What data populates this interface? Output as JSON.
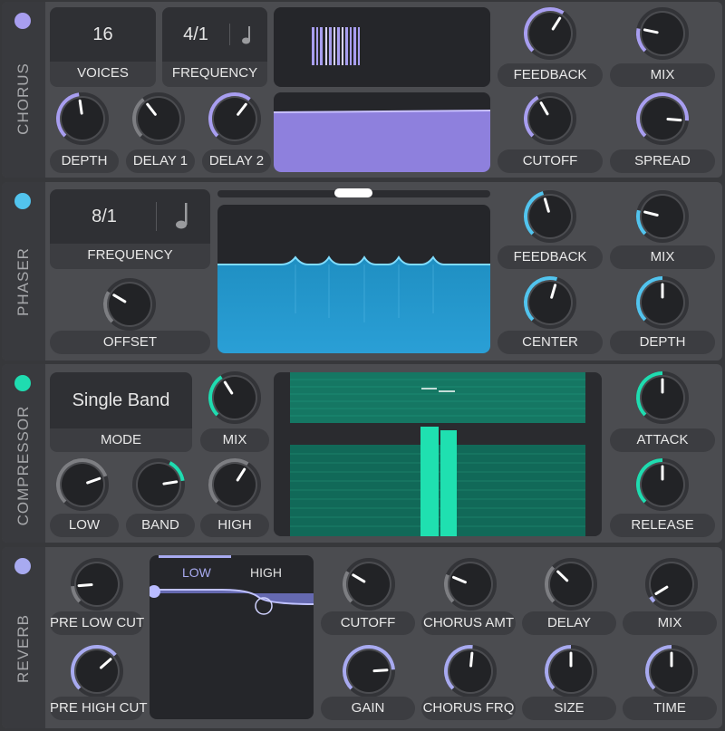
{
  "colors": {
    "chorus": "#a89ef0",
    "phaser": "#52c4ee",
    "compressor": "#1fdcb0",
    "reverb": "#a8aaf0"
  },
  "chorus": {
    "title": "CHORUS",
    "voices_value": "16",
    "voices_label": "VOICES",
    "frequency_value": "4/1",
    "frequency_label": "FREQUENCY",
    "knobs": {
      "depth": "DEPTH",
      "delay1": "DELAY 1",
      "delay2": "DELAY 2",
      "feedback": "FEEDBACK",
      "mix": "MIX",
      "cutoff": "CUTOFF",
      "spread": "SPREAD"
    }
  },
  "phaser": {
    "title": "PHASER",
    "frequency_value": "8/1",
    "frequency_label": "FREQUENCY",
    "knobs": {
      "offset": "OFFSET",
      "feedback": "FEEDBACK",
      "mix": "MIX",
      "center": "CENTER",
      "depth": "DEPTH"
    }
  },
  "compressor": {
    "title": "COMPRESSOR",
    "mode_value": "Single Band",
    "mode_label": "MODE",
    "knobs": {
      "mix": "MIX",
      "low": "LOW",
      "band": "BAND",
      "high": "HIGH",
      "attack": "ATTACK",
      "release": "RELEASE"
    }
  },
  "reverb": {
    "title": "REVERB",
    "tabs": {
      "low": "LOW",
      "high": "HIGH"
    },
    "knobs": {
      "pre_low_cut": "PRE LOW CUT",
      "pre_high_cut": "PRE HIGH CUT",
      "cutoff": "CUTOFF",
      "chorus_amt": "CHORUS AMT",
      "delay": "DELAY",
      "mix": "MIX",
      "gain": "GAIN",
      "chorus_frq": "CHORUS FRQ",
      "size": "SIZE",
      "time": "TIME"
    }
  }
}
